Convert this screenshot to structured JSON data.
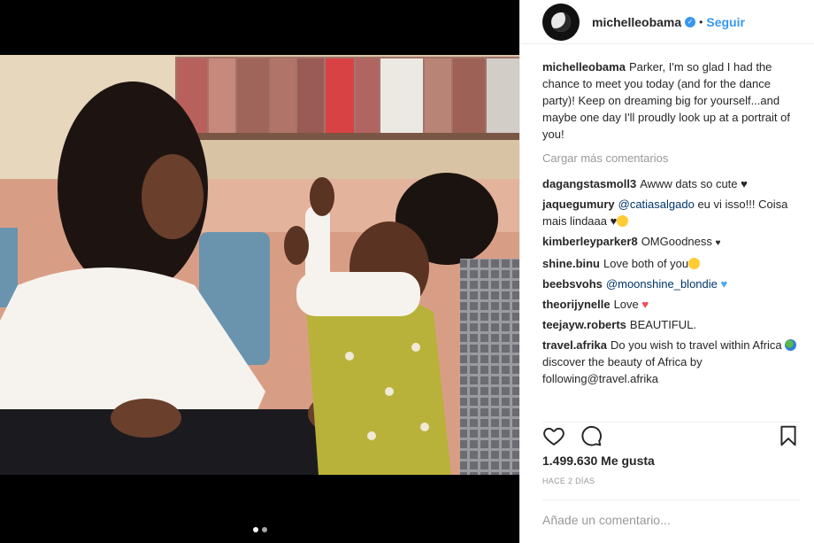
{
  "header": {
    "username": "michelleobama",
    "separator": "•",
    "follow_label": "Seguir"
  },
  "caption": {
    "username": "michelleobama",
    "text": "Parker, I'm so glad I had the chance to meet you today (and for the dance party)! Keep on dreaming big for yourself...and maybe one day I'll proudly look up at a portrait of you!"
  },
  "load_more": "Cargar más comentarios",
  "comments": [
    {
      "user": "dagangstasmoll3",
      "text": "Awww dats so cute ",
      "emoji": "black-heart"
    },
    {
      "user": "jaquegumury",
      "mention": "@catiasalgado",
      "text": "eu vi isso!!! Coisa mais lindaaa ",
      "emoji": "black-heart-heart-eyes"
    },
    {
      "user": "kimberleyparker8",
      "text": "OMGoodness ",
      "emoji": "small-black-heart"
    },
    {
      "user": "shine.binu",
      "text": "Love both of you",
      "emoji": "kiss-face"
    },
    {
      "user": "beebsvohs",
      "mention": "@moonshine_blondie",
      "text": " ",
      "emoji": "blue-heart"
    },
    {
      "user": "theorijynelle",
      "text": "Love ",
      "emoji": "red-heart"
    },
    {
      "user": "teejayw.roberts",
      "text": "BEAUTIFUL."
    },
    {
      "user": "travel.afrika",
      "text": "Do you wish to travel within Africa ",
      "emoji": "globe",
      "text2": " discover the beauty of Africa by following@travel.afrika"
    }
  ],
  "actions": {
    "like_icon": "heart-outline-icon",
    "comment_icon": "comment-bubble-icon",
    "save_icon": "bookmark-icon"
  },
  "likes": "1.499.630 Me gusta",
  "timestamp": "Hace 2 días",
  "add_comment": {
    "placeholder": "Añade un comentario..."
  },
  "carousel": {
    "count": 2,
    "active": 1
  },
  "colors": {
    "accent": "#3897f0",
    "mention": "#003569",
    "muted": "#999999"
  }
}
